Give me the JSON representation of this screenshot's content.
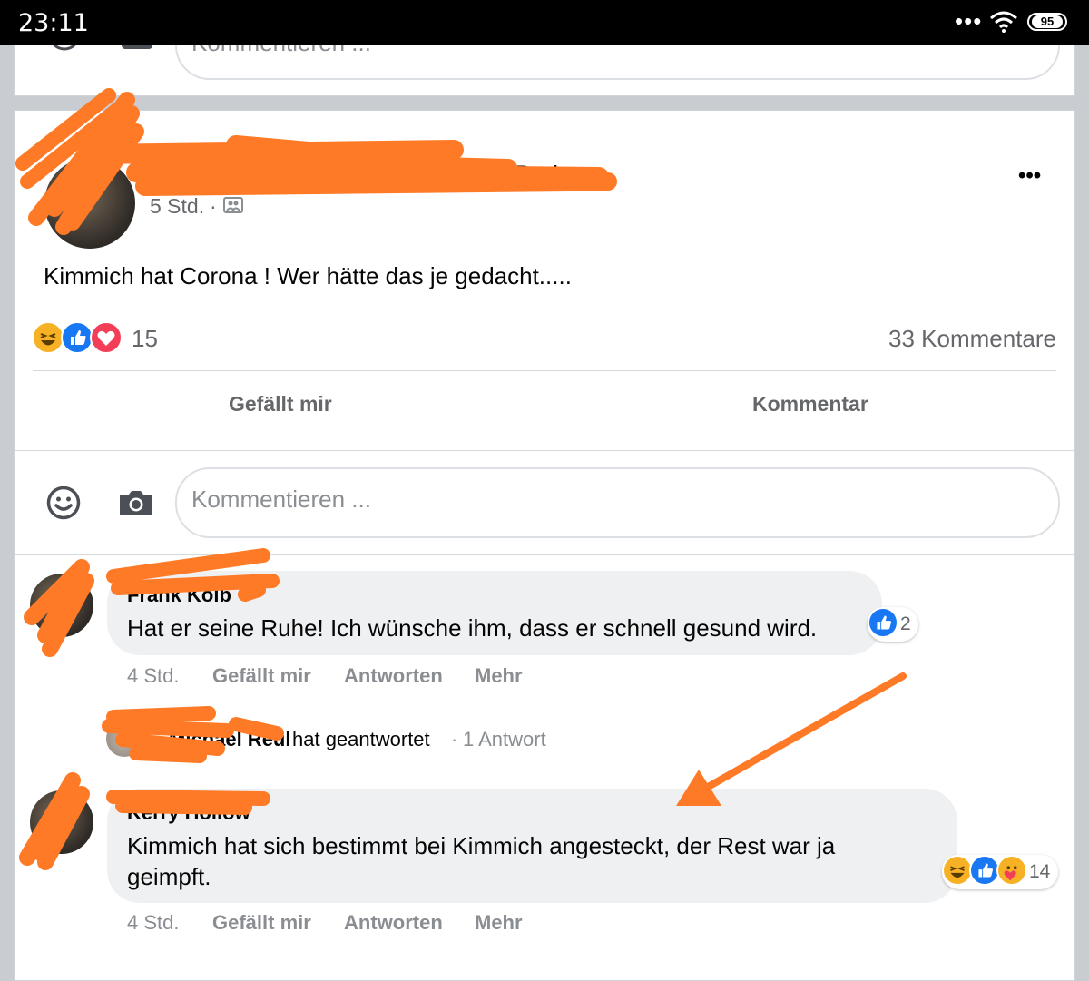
{
  "status_bar": {
    "time": "23:11",
    "more": "•••",
    "battery": "95"
  },
  "top_card": {
    "comment_placeholder": "Kommentieren ..."
  },
  "post": {
    "author": "Buchbinder Becker",
    "time": "5 Std.",
    "separator": "·",
    "audience_icon": "friends-icon",
    "more": "•••",
    "text": "Kimmich hat Corona ! Wer hätte das je gedacht.....",
    "reactions": {
      "icons": [
        "haha",
        "like",
        "love"
      ],
      "count": "15"
    },
    "comments_count": "33 Kommentare",
    "actions": {
      "like": "Gefällt mir",
      "comment": "Kommentar"
    },
    "comment_placeholder": "Kommentieren ..."
  },
  "comments": [
    {
      "name": "Frank Kolb",
      "text": "Hat er seine Ruhe! Ich wünsche ihm, dass er schnell gesund wird.",
      "reaction_count": "2",
      "time": "4 Std.",
      "actions": {
        "like": "Gefällt mir",
        "reply": "Antworten",
        "more": "Mehr"
      },
      "reply_summary": {
        "name": "Michael Reul",
        "text": "hat geantwortet",
        "separator": "·",
        "count": "1 Antwort"
      }
    },
    {
      "name": "Kerry Hollow",
      "text_line1": "Kimmich hat sich bestimmt bei Kimmich angesteckt, der Rest war ja",
      "text_line2": "geimpft.",
      "reaction_count": "14",
      "time": "4 Std.",
      "actions": {
        "like": "Gefällt mir",
        "reply": "Antworten",
        "more": "Mehr"
      }
    }
  ],
  "colors": {
    "annotation": "#ff7a26",
    "like_blue": "#1877f2",
    "love_red": "#f33e58",
    "haha_yellow": "#f7b125"
  }
}
